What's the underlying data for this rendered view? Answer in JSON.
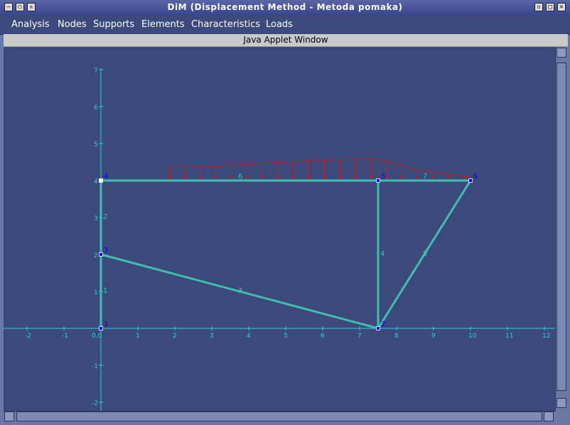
{
  "window": {
    "title": "DiM (Displacement Method - Metoda pomaka)"
  },
  "menu": [
    "Analysis",
    "Nodes",
    "Supports",
    "Elements",
    "Characteristics",
    "Loads"
  ],
  "banner": "Java Applet Window",
  "diagram": {
    "axis_color": "#2ad0e0",
    "element_color": "#3fbfb0",
    "load_color": "#cc1a1a",
    "node_color": "#0000ff",
    "x_ticks": [
      "-2",
      "-1",
      "0,0",
      "1",
      "2",
      "3",
      "4",
      "5",
      "6",
      "7",
      "8",
      "9",
      "10",
      "11",
      "12"
    ],
    "y_ticks": [
      "7",
      "6",
      "5",
      "4",
      "3",
      "2",
      "1",
      "-1",
      "-2"
    ],
    "nodes": [
      {
        "id": "1",
        "x": 0,
        "y": 0
      },
      {
        "id": "2",
        "x": 7.5,
        "y": 0
      },
      {
        "id": "3",
        "x": 0,
        "y": 2
      },
      {
        "id": "4",
        "x": 0,
        "y": 4
      },
      {
        "id": "5",
        "x": 7.5,
        "y": 4
      },
      {
        "id": "6",
        "x": 10,
        "y": 4
      }
    ],
    "elements": [
      {
        "id": "1",
        "from": "1",
        "to": "3"
      },
      {
        "id": "2",
        "from": "3",
        "to": "4"
      },
      {
        "id": "3",
        "from": "3",
        "to": "2"
      },
      {
        "id": "4",
        "from": "2",
        "to": "5"
      },
      {
        "id": "5",
        "from": "2",
        "to": "6"
      },
      {
        "id": "6",
        "from": "4",
        "to": "5"
      },
      {
        "id": "7",
        "from": "5",
        "to": "6"
      }
    ],
    "load": {
      "x_start": 1.85,
      "x_end": 10,
      "intensity": [
        [
          1.85,
          0.35
        ],
        [
          3.0,
          0.38
        ],
        [
          4.0,
          0.44
        ],
        [
          5.0,
          0.5
        ],
        [
          6.0,
          0.55
        ],
        [
          7.0,
          0.58
        ],
        [
          7.5,
          0.58
        ],
        [
          8.5,
          0.3
        ],
        [
          10,
          0.08
        ]
      ]
    }
  }
}
